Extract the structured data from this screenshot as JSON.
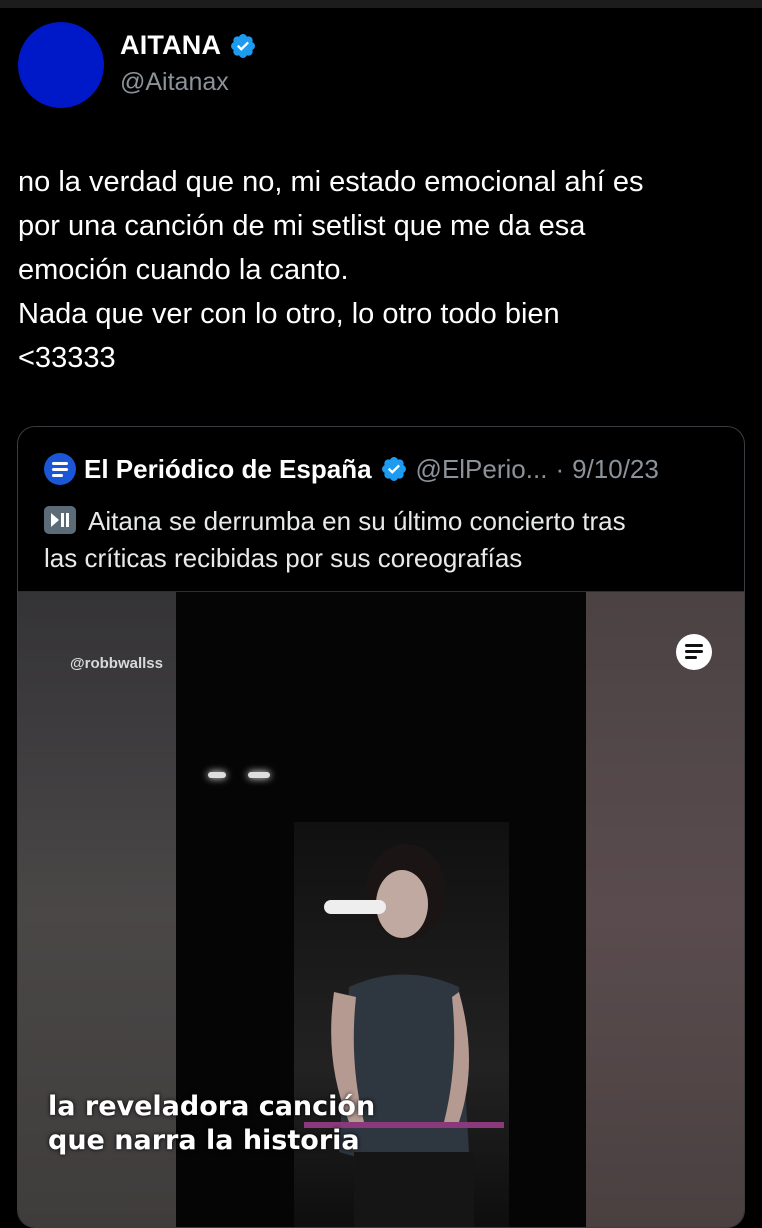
{
  "tweet": {
    "author_name": "AITANA",
    "author_handle": "@Aitanax",
    "avatar_color": "#0019c8",
    "verified_color": "#1d9bf0",
    "text_lines": [
      "no la verdad que no, mi estado emocional ahí es",
      "por una canción de mi setlist que me da esa",
      "emoción cuando la canto.",
      "Nada que ver con lo otro, lo otro todo bien",
      "<33333"
    ]
  },
  "quote": {
    "author_name": "El Periódico de España",
    "author_handle": "@ElPerio...",
    "separator": "·",
    "date": "9/10/23",
    "text_lines": [
      "Aitana se derrumba en su último concierto tras",
      "las críticas recibidas por sus coreografías"
    ],
    "logo_color": "#1a56d6",
    "media": {
      "watermark": "@robbwallss",
      "subtitle_lines": [
        "la reveladora canción",
        "que narra la historia"
      ]
    }
  }
}
